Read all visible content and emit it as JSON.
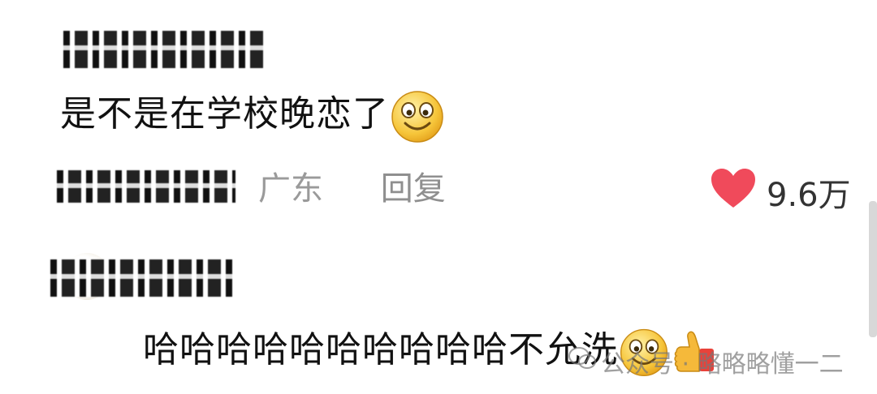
{
  "comments": [
    {
      "username_redacted": true,
      "text": "是不是在学校晚恋了",
      "emoji": "smile-emoji",
      "location": "广东",
      "reply_label": "回复",
      "likes": "9.6万",
      "like_color": "#f04a5b"
    },
    {
      "username_redacted": true,
      "text": "哈哈哈哈哈哈哈哈哈哈不允洗",
      "emoji": "smile-emoji",
      "extra_emoji": "thumbs-up-emoji"
    }
  ],
  "watermark": {
    "text": "公众号 · 略略略懂一二",
    "icon": "wechat-icon"
  }
}
